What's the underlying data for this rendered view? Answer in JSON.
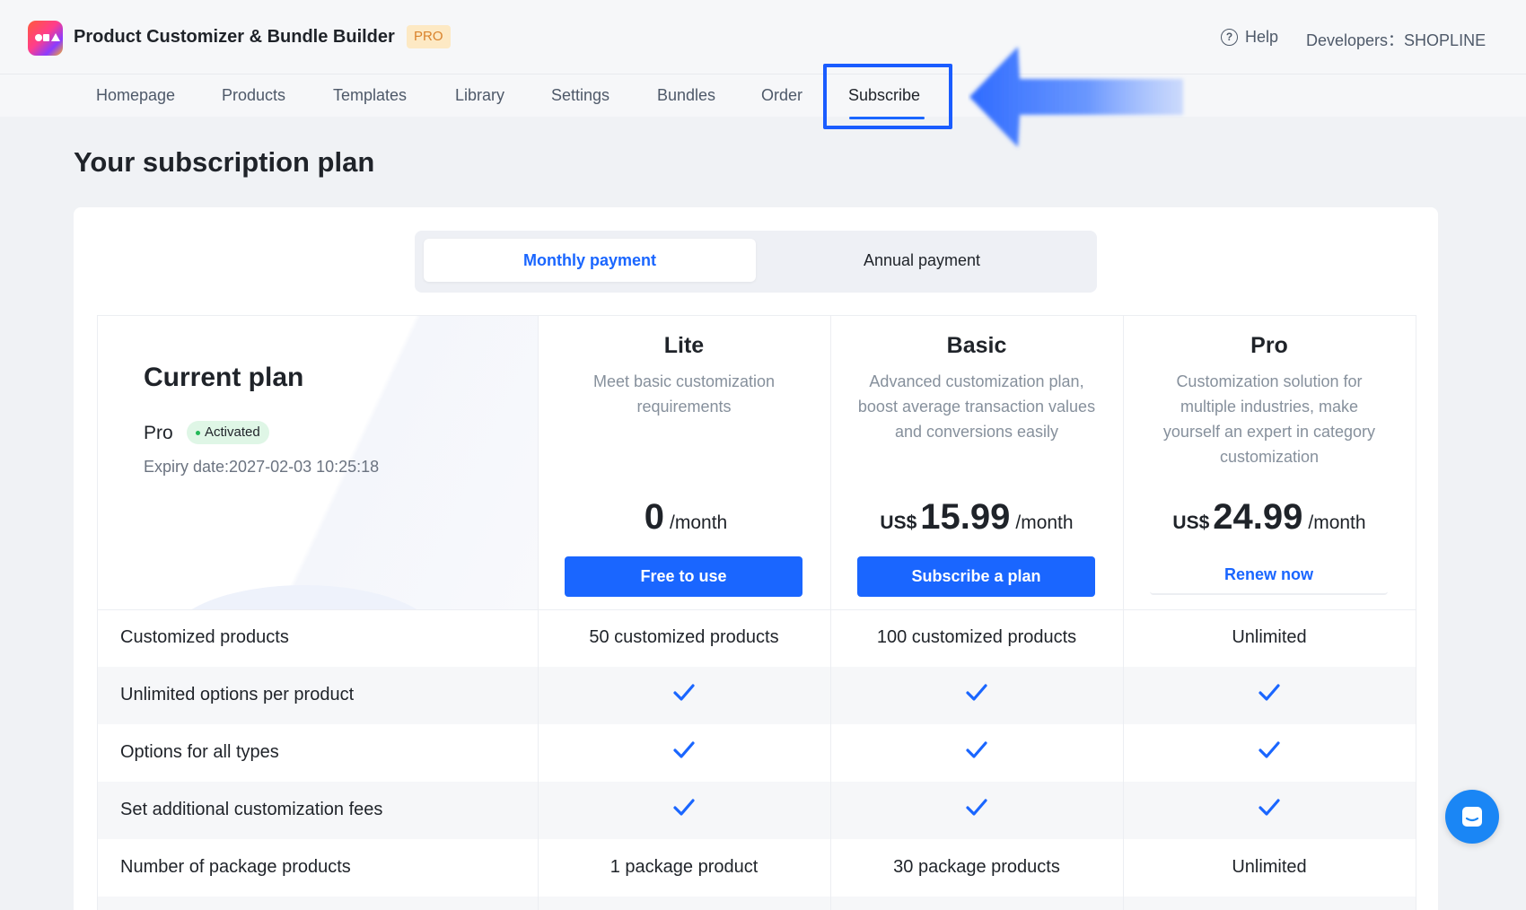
{
  "header": {
    "app_title": "Product Customizer & Bundle Builder",
    "badge": "PRO",
    "help": "Help",
    "developers": "Developers：SHOPLINE"
  },
  "nav": {
    "tabs": [
      "Homepage",
      "Products",
      "Templates",
      "Library",
      "Settings",
      "Bundles",
      "Order",
      "Subscribe"
    ],
    "active": "Subscribe"
  },
  "page": {
    "title": "Your subscription plan"
  },
  "billing_toggle": {
    "monthly": "Monthly payment",
    "annual": "Annual payment",
    "selected": "Monthly payment"
  },
  "current": {
    "title": "Current plan",
    "plan": "Pro",
    "status": "Activated",
    "expiry": "Expiry date:2027-02-03 10:25:18"
  },
  "plans": [
    {
      "name": "Lite",
      "desc": "Meet basic customization requirements",
      "currency": "",
      "amount": "0",
      "per": "/month",
      "button": "Free to use"
    },
    {
      "name": "Basic",
      "desc": "Advanced customization plan, boost average transaction values and conversions easily",
      "currency": "US$",
      "amount": "15.99",
      "per": "/month",
      "button": "Subscribe a plan"
    },
    {
      "name": "Pro",
      "desc": "Customization solution for multiple industries, make yourself an expert in category customization",
      "currency": "US$",
      "amount": "24.99",
      "per": "/month",
      "button": "Renew now"
    }
  ],
  "features": [
    {
      "label": "Customized products",
      "values": [
        "50 customized products",
        "100 customized products",
        "Unlimited"
      ]
    },
    {
      "label": "Unlimited options per product",
      "values": [
        true,
        true,
        true
      ]
    },
    {
      "label": "Options for all types",
      "values": [
        true,
        true,
        true
      ]
    },
    {
      "label": "Set additional customization fees",
      "values": [
        true,
        true,
        true
      ]
    },
    {
      "label": "Number of package products",
      "values": [
        "1 package product",
        "30 package products",
        "Unlimited"
      ]
    }
  ],
  "colors": {
    "accent": "#1a66ff",
    "activated_bg": "#dff6e6",
    "activated_dot": "#23b857",
    "badge_bg": "#fde9c4",
    "badge_text": "#d9822b"
  }
}
